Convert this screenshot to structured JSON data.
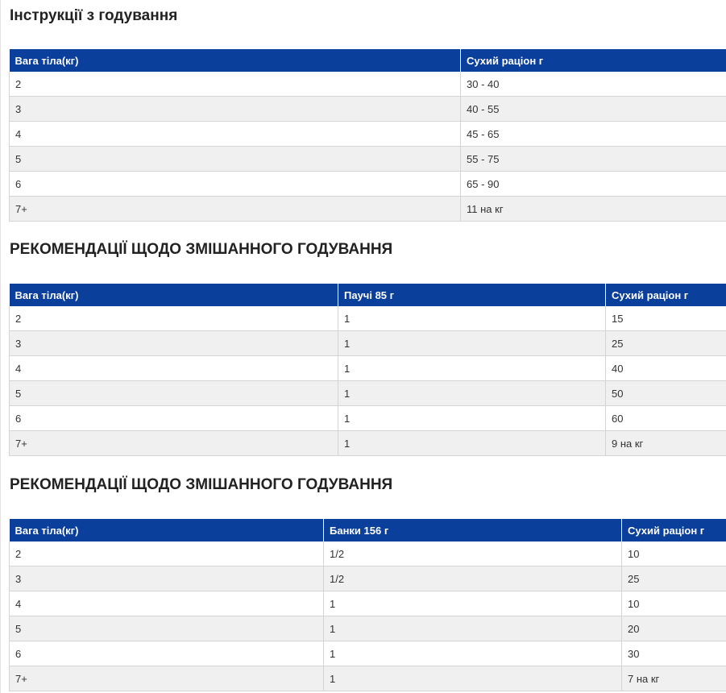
{
  "section1": {
    "title": "Інструкції з годування",
    "headers": [
      "Вага тіла(кг)",
      "Сухий раціон г"
    ],
    "rows": [
      [
        "2",
        "30 - 40"
      ],
      [
        "3",
        "40 - 55"
      ],
      [
        "4",
        "45 - 65"
      ],
      [
        "5",
        "55 - 75"
      ],
      [
        "6",
        "65 - 90"
      ],
      [
        "7+",
        "11 на кг"
      ]
    ]
  },
  "section2": {
    "title": "РЕКОМЕНДАЦІЇ ЩОДО ЗМІШАННОГО ГОДУВАННЯ",
    "headers": [
      "Вага тіла(кг)",
      "Паучі 85 г",
      "Сухий раціон г"
    ],
    "rows": [
      [
        "2",
        "1",
        "15"
      ],
      [
        "3",
        "1",
        "25"
      ],
      [
        "4",
        "1",
        "40"
      ],
      [
        "5",
        "1",
        "50"
      ],
      [
        "6",
        "1",
        "60"
      ],
      [
        "7+",
        "1",
        "9 на кг"
      ]
    ]
  },
  "section3": {
    "title": "РЕКОМЕНДАЦІЇ ЩОДО ЗМІШАННОГО ГОДУВАННЯ",
    "headers": [
      "Вага тіла(кг)",
      "Банки 156 г",
      "Сухий раціон г"
    ],
    "rows": [
      [
        "2",
        "1/2",
        "10"
      ],
      [
        "3",
        "1/2",
        "25"
      ],
      [
        "4",
        "1",
        "10"
      ],
      [
        "5",
        "1",
        "20"
      ],
      [
        "6",
        "1",
        "30"
      ],
      [
        "7+",
        "1",
        "7 на кг"
      ]
    ]
  },
  "colors": {
    "header_bg": "#0a3f9c",
    "stripe": "#f0f0f0"
  }
}
